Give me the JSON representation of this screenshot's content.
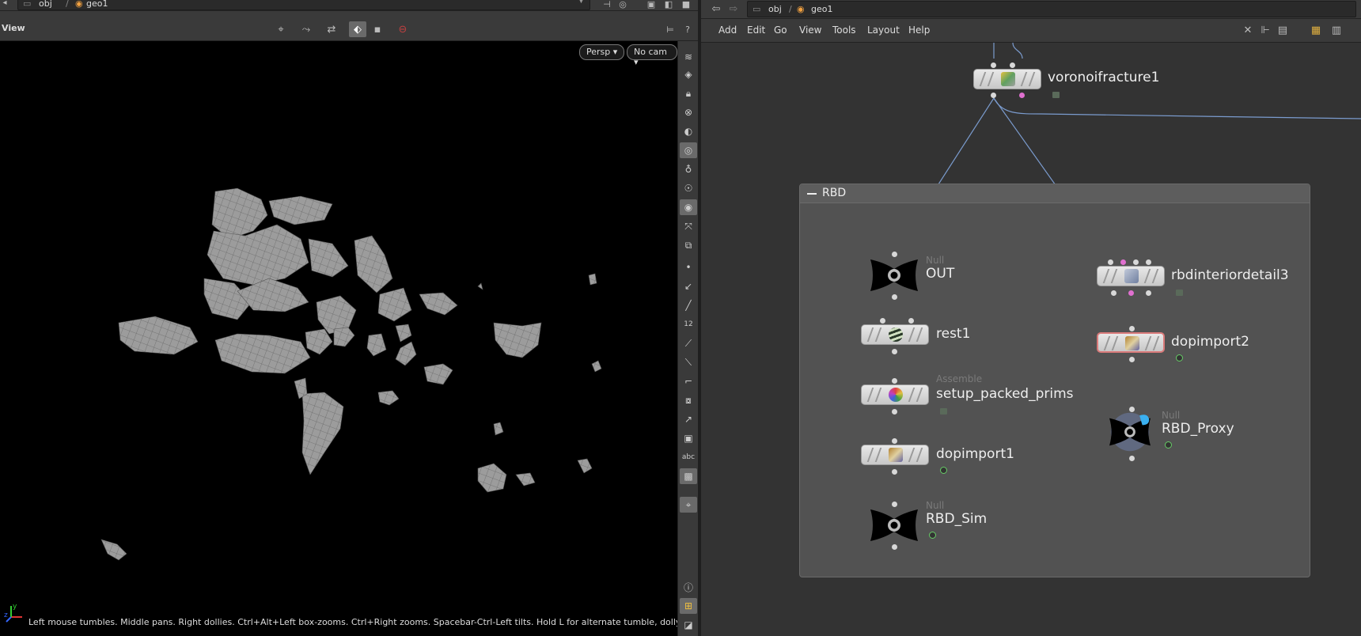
{
  "left_pane": {
    "path": {
      "crumb1": "obj",
      "crumb2": "geo1"
    },
    "viewbar_label": "View",
    "viewport": {
      "projection": "Persp",
      "camera": "No cam",
      "hint": "Left mouse tumbles. Middle pans. Right dollies. Ctrl+Alt+Left box-zooms. Ctrl+Right zooms. Spacebar-Ctrl-Left tilts. Hold L for alternate tumble, dolly, and zoom."
    },
    "axis": {
      "x": "x",
      "y": "y",
      "z": "z"
    },
    "right_tools": {
      "num_label": "12",
      "abc_label": "abc"
    }
  },
  "right_pane": {
    "path": {
      "crumb1": "obj",
      "crumb2": "geo1"
    },
    "menu": [
      "Add",
      "Edit",
      "Go",
      "View",
      "Tools",
      "Layout",
      "Help"
    ],
    "network_box_title": "RBD",
    "nodes": {
      "voronoi": "voronoifracture1",
      "out_type": "Null",
      "out": "OUT",
      "rest": "rest1",
      "setup_type": "Assemble",
      "setup": "setup_packed_prims",
      "dopimport1": "dopimport1",
      "sim_type": "Null",
      "sim": "RBD_Sim",
      "rbdinterior": "rbdinteriordetail3",
      "dopimport2": "dopimport2",
      "proxy_type": "Null",
      "proxy": "RBD_Proxy"
    }
  },
  "colors": {
    "accent_pink": "#e070d0",
    "wire": "#7b9ccf",
    "selected": "#d97a7a"
  }
}
